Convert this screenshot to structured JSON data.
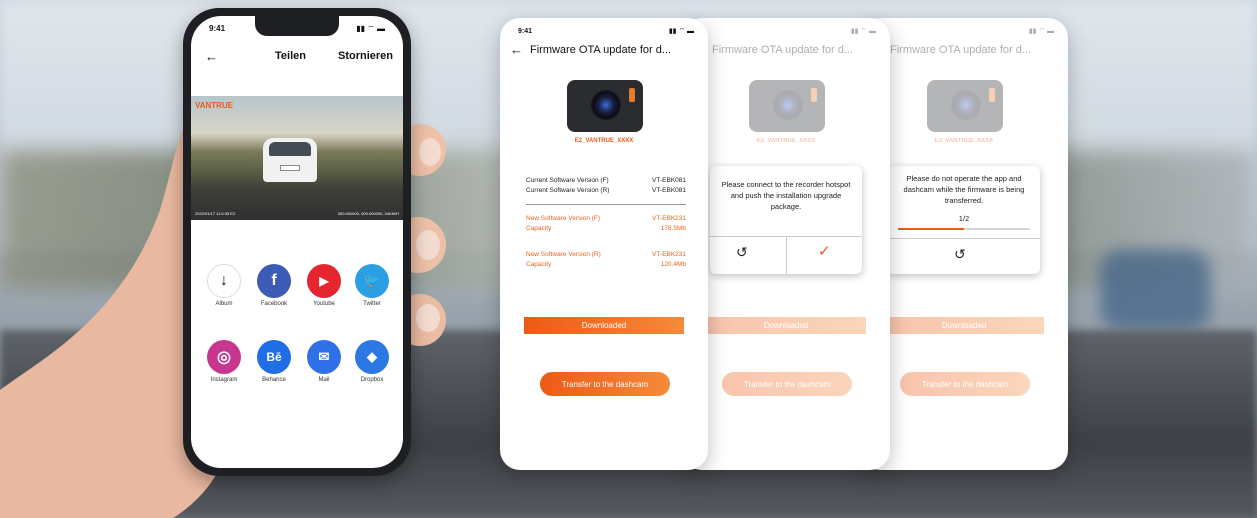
{
  "phone": {
    "time": "9:41",
    "share_title": "Teilen",
    "cancel_label": "Stornieren",
    "video_brand": "VANTRUE",
    "video_timestamp": "2022/01/17  11:5:35  E2",
    "video_coords": "000.000000,  000.000000,  34KM/H",
    "apps": [
      {
        "label": "Album",
        "icon": "download-arrow-icon",
        "glyph": "↓",
        "color": "#ffffff"
      },
      {
        "label": "Facebook",
        "icon": "facebook-icon",
        "glyph": "f",
        "color": "#3b5bb5"
      },
      {
        "label": "Youtube",
        "icon": "youtube-icon",
        "glyph": "▶",
        "color": "#e6262e"
      },
      {
        "label": "Twitter",
        "icon": "twitter-icon",
        "glyph": "🐦",
        "color": "#2c9fe2"
      },
      {
        "label": "Instagram",
        "icon": "instagram-icon",
        "glyph": "◎",
        "color": "#c8378f"
      },
      {
        "label": "Behance",
        "icon": "behance-icon",
        "glyph": "Bē",
        "color": "#1f6ee6"
      },
      {
        "label": "Mail",
        "icon": "mail-icon",
        "glyph": "✉",
        "color": "#2f6fe8"
      },
      {
        "label": "Dropbox",
        "icon": "dropbox-icon",
        "glyph": "◆",
        "color": "#2b78e4"
      }
    ]
  },
  "screen1": {
    "time": "9:41",
    "title": "Firmware OTA update for d...",
    "device_name": "E2_VANTRUE_XXXX",
    "current_f_label": "Current Software Version (F)",
    "current_f_value": "VT-EBK081",
    "current_r_label": "Current Software Version (R)",
    "current_r_value": "VT-EBK081",
    "new_f_label": "New Software Version (F)",
    "new_f_value": "VT-EBK231",
    "capacity_f_label": "Capacity",
    "capacity_f_value": "178.5Mb",
    "new_r_label": "New Software Version (R)",
    "new_r_value": "VT-EBK231",
    "capacity_r_label": "Capacity",
    "capacity_r_value": "120.4Mb",
    "downloaded_label": "Downloaded",
    "transfer_label": "Transfer to the dashcam"
  },
  "screen2": {
    "title": "Firmware OTA update for d...",
    "device_name": "E2_VANTRUE_XXXX",
    "dialog_text": "Please connect to the recorder hotspot and push the installation upgrade package.",
    "downloaded_label": "Downloaded",
    "transfer_label": "Transfer to the dashcam"
  },
  "screen3": {
    "title": "Firmware OTA update for d...",
    "device_name": "E2_VANTRUE_XXXX",
    "dialog_text": "Please do not operate the app and dashcam while the firmware is being transferred.",
    "progress_text": "1/2",
    "progress": 0.5,
    "downloaded_label": "Downloaded",
    "transfer_label": "Transfer to the dashcam"
  },
  "colors": {
    "accent": "#ee5a16",
    "accent_light": "#f48b3b"
  }
}
